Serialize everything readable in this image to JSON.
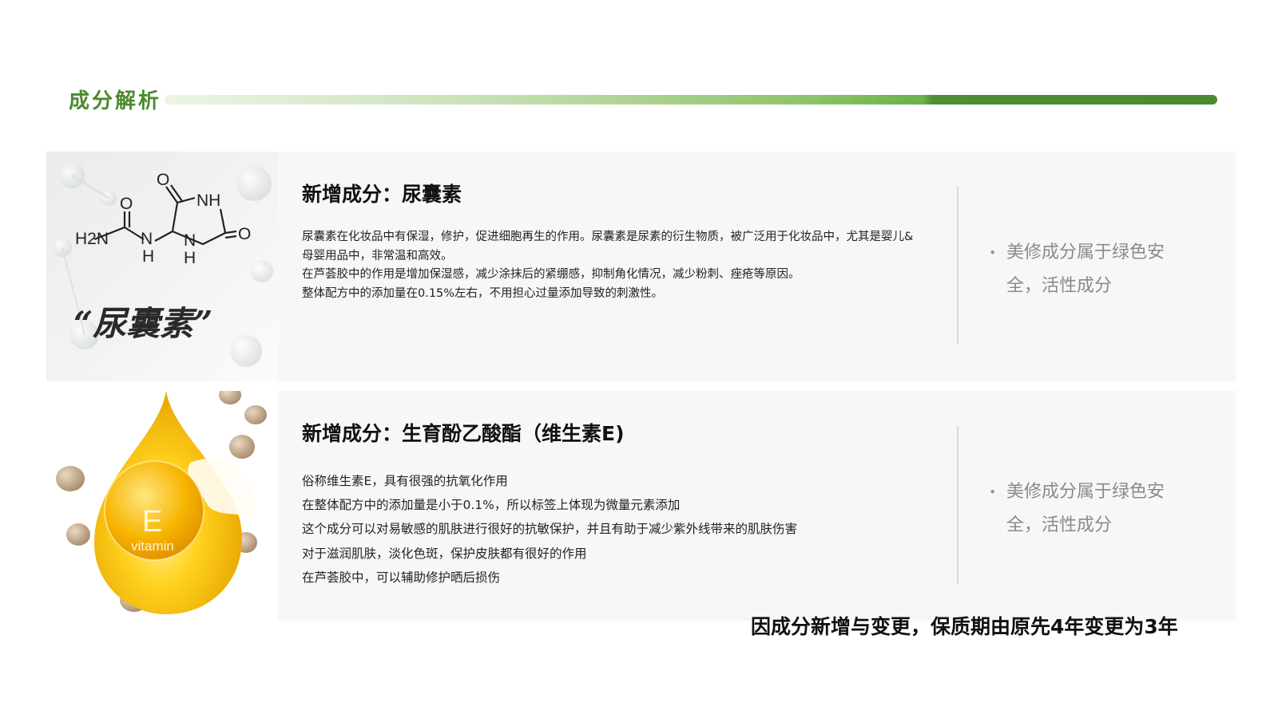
{
  "header": {
    "title": "成分解析",
    "accent_color": "#4c8a2e"
  },
  "cards": [
    {
      "image_caption": "“尿囊素”",
      "molecule_labels": [
        "O",
        "NH",
        "O",
        "H2N",
        "N",
        "H",
        "N",
        "H",
        "O"
      ],
      "title": "新增成分：尿囊素",
      "lines": [
        "尿囊素在化妆品中有保湿，修护，促进细胞再生的作用。尿囊素是尿素的衍生物质，被广泛用于化妆品中，尤其是婴儿&",
        "母婴用品中，非常温和高效。",
        "在芦荟胶中的作用是增加保湿感，减少涂抹后的紧绷感，抑制角化情况，减少粉刺、痤疮等原因。",
        "整体配方中的添加量在0.15%左右，不用担心过量添加导致的刺激性。"
      ],
      "side_note": "美修成分属于绿色安全，活性成分"
    },
    {
      "image_badge_letter": "E",
      "image_badge_word": "vitamin",
      "title": "新增成分：生育酚乙酸酯（维生素E)",
      "lines": [
        "俗称维生素E，具有很强的抗氧化作用",
        "在整体配方中的添加量是小于0.1%，所以标签上体现为微量元素添加",
        "这个成分可以对易敏感的肌肤进行很好的抗敏保护，并且有助于减少紫外线带来的肌肤伤害",
        "对于滋润肌肤，淡化色斑，保护皮肤都有很好的作用",
        "在芦荟胶中，可以辅助修护晒后损伤"
      ],
      "side_note": "美修成分属于绿色安全，活性成分"
    }
  ],
  "footer": {
    "note": "因成分新增与变更，保质期由原先4年变更为3年"
  }
}
